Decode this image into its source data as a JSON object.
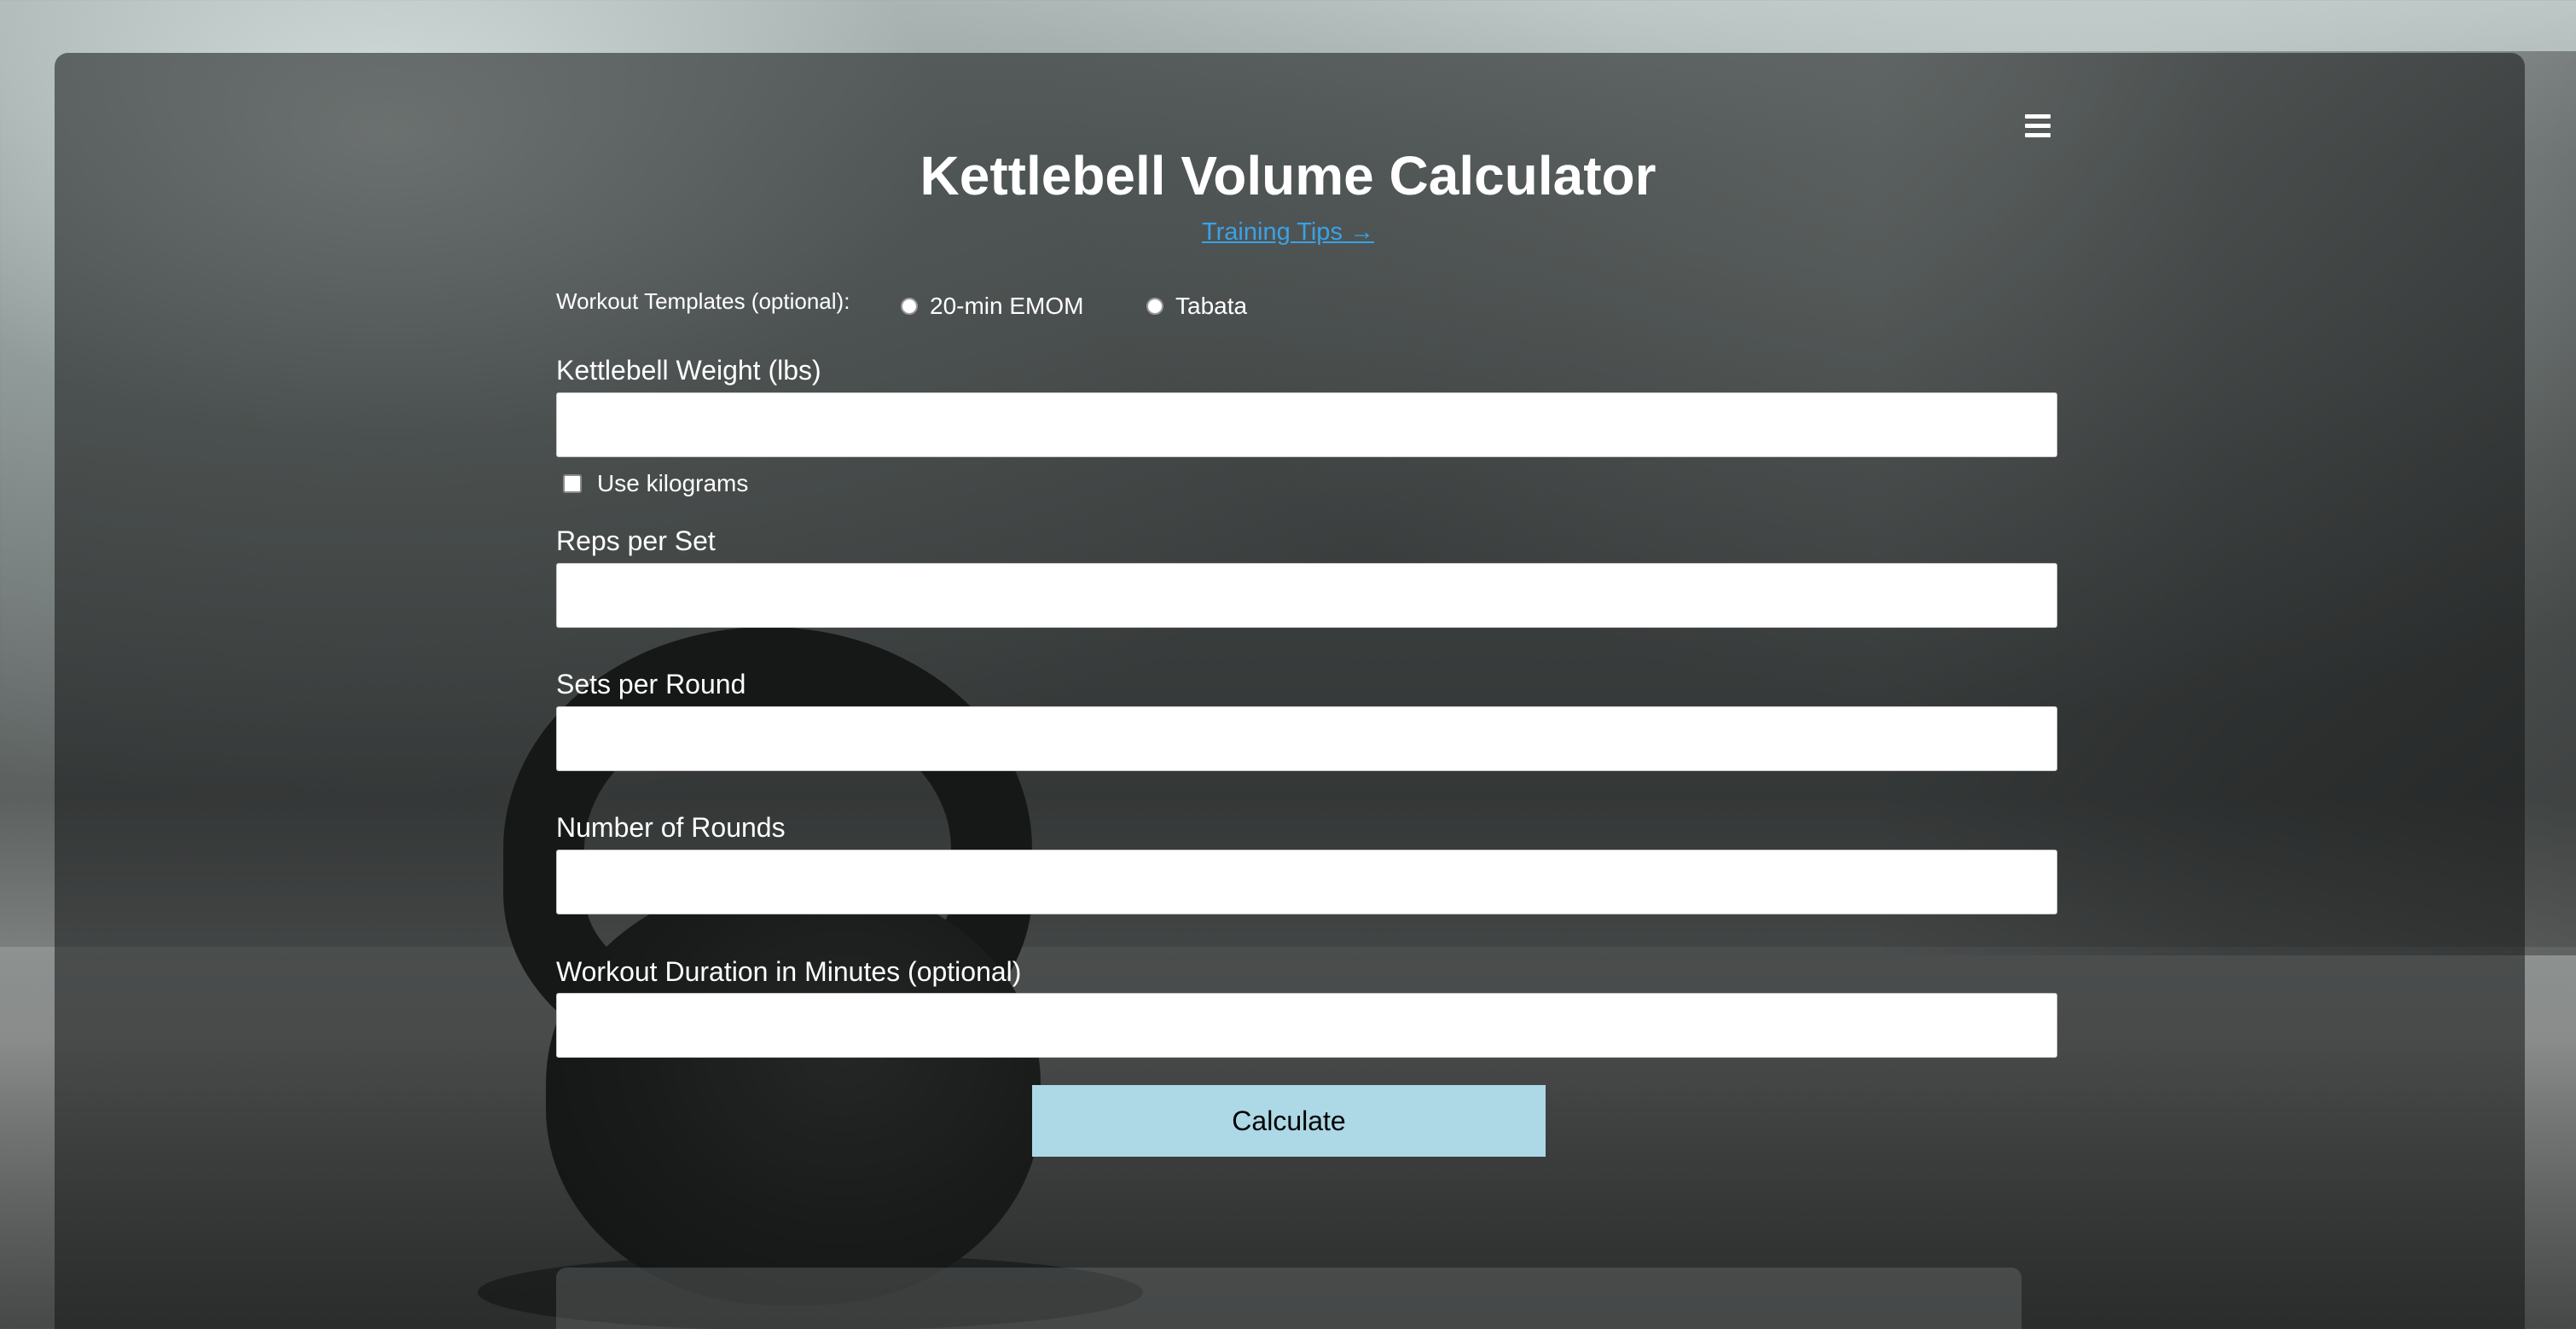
{
  "header": {
    "title": "Kettlebell Volume Calculator",
    "tips_link": "Training Tips →",
    "menu_icon": "hamburger-menu-icon"
  },
  "templates": {
    "label": "Workout Templates (optional):",
    "options": [
      {
        "label": "20-min EMOM",
        "selected": false
      },
      {
        "label": "Tabata",
        "selected": false
      }
    ]
  },
  "fields": {
    "weight": {
      "label": "Kettlebell Weight (lbs)",
      "value": ""
    },
    "use_kg": {
      "label": "Use kilograms",
      "checked": false
    },
    "reps": {
      "label": "Reps per Set",
      "value": ""
    },
    "sets": {
      "label": "Sets per Round",
      "value": ""
    },
    "rounds": {
      "label": "Number of Rounds",
      "value": ""
    },
    "duration": {
      "label": "Workout Duration in Minutes (optional)",
      "value": ""
    }
  },
  "actions": {
    "calculate_label": "Calculate"
  },
  "colors": {
    "link": "#3aa2e6",
    "button_bg": "#add8e6",
    "panel_bg": "rgba(20,22,22,0.55)"
  }
}
